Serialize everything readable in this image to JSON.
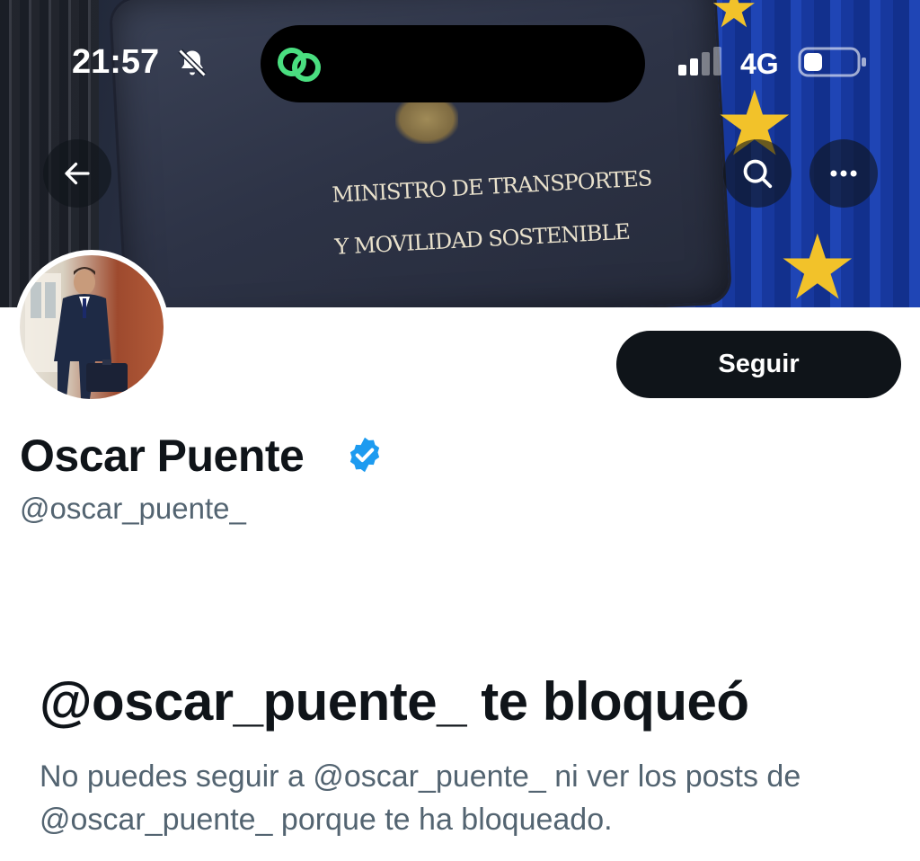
{
  "status_bar": {
    "time": "21:57",
    "network": "4G",
    "icons": [
      "bell-off-icon",
      "island-app-icon",
      "signal-icon",
      "battery-icon"
    ]
  },
  "banner": {
    "plate_line1": "MINISTRO DE TRANSPORTES",
    "plate_line2": "Y MOVILIDAD SOSTENIBLE",
    "buttons": [
      "back-arrow-icon",
      "search-icon",
      "more-icon"
    ]
  },
  "profile": {
    "name": "Oscar Puente",
    "handle": "@oscar_puente_",
    "follow_label": "Seguir",
    "verified_color": "#1d9bf0"
  },
  "blocked": {
    "title": "@oscar_puente_ te bloqueó",
    "description": "No puedes seguir a @oscar_puente_ ni ver los posts de @oscar_puente_ porque te ha bloqueado."
  },
  "colors": {
    "primary_text": "#0f1419",
    "secondary_text": "#536471",
    "button_bg": "#0f1419",
    "accent_green": "#4ade80"
  }
}
